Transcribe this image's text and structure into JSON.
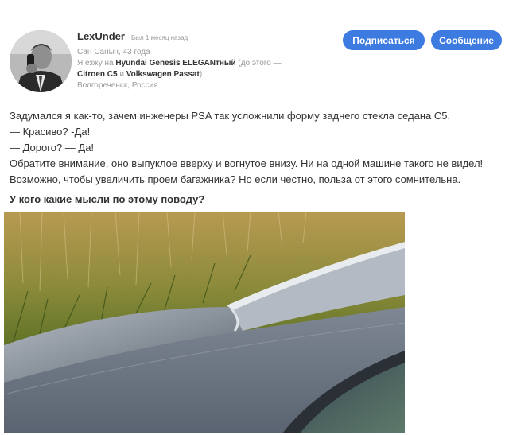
{
  "profile": {
    "username": "LexUnder",
    "last_seen": "Был 1 месяц назад",
    "name_age": "Сан Саныч, 43 года",
    "drives_prefix": "Я езжу на ",
    "drives_car": "Hyundai Genesis ELEGANтный",
    "drives_prev_prefix": " (до этого —",
    "prev_car_1": "Citroen C5",
    "prev_and": " и ",
    "prev_car_2": "Volkswagen Passat",
    "prev_close": ")",
    "location": "Волгореченск, Россия"
  },
  "actions": {
    "subscribe_label": "Подписаться",
    "message_label": "Сообщение"
  },
  "post": {
    "lines": [
      "Задумался я как-то, зачем инженеры PSA так усложнили форму заднего стекла седана С5.",
      "— Красиво? -Да!",
      "— Дорого? — Да!",
      "Обратите внимание, оно выпуклое вверху и вогнутое внизу. Ни на одной машине такого не видел!",
      "Возможно, чтобы увеличить проем багажника? Но если честно, польза от этого сомнительна."
    ],
    "question": "У кого какие мысли по этому поводу?"
  },
  "colors": {
    "accent": "#3d7be0"
  }
}
